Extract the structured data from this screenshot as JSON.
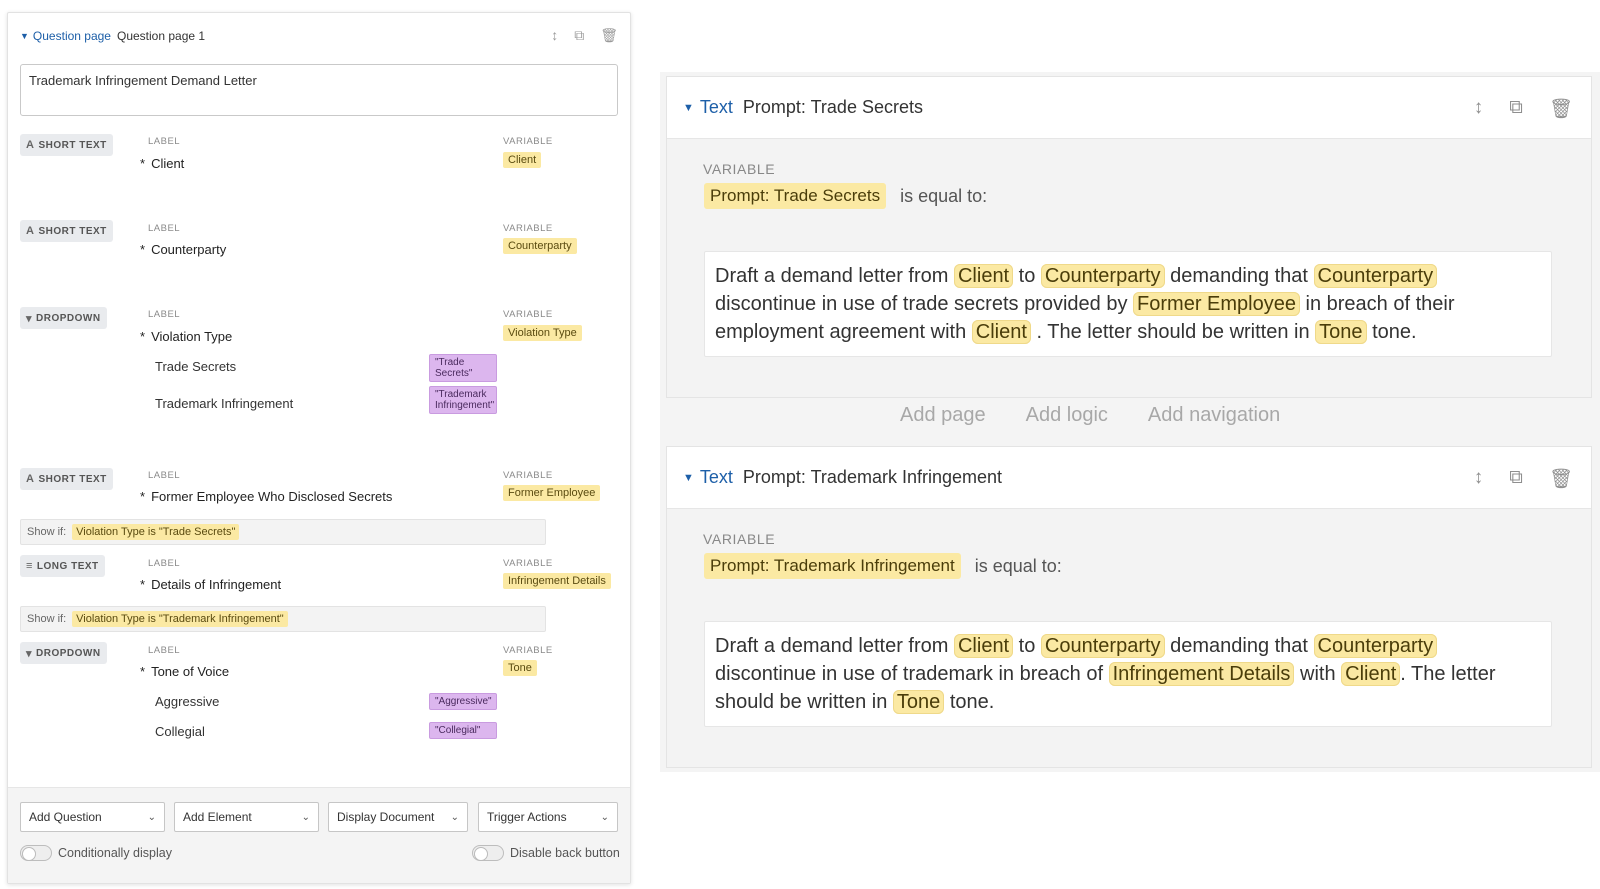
{
  "left": {
    "page_type": "Question page",
    "page_name": "Question page 1",
    "title_value": "Trademark Infringement Demand Letter",
    "label_caption": "LABEL",
    "variable_caption": "VARIABLE",
    "questions": [
      {
        "type": "SHORT TEXT",
        "label": "Client",
        "variable": "Client"
      },
      {
        "type": "SHORT TEXT",
        "label": "Counterparty",
        "variable": "Counterparty"
      },
      {
        "type": "DROPDOWN",
        "label": "Violation Type",
        "variable": "Violation Type",
        "options": [
          {
            "label": "Trade Secrets",
            "value": "\"Trade Secrets\""
          },
          {
            "label": "Trademark Infringement",
            "value": "\"Trademark Infringement\""
          }
        ]
      },
      {
        "type": "SHORT TEXT",
        "label": "Former Employee Who Disclosed Secrets",
        "variable": "Former Employee",
        "show_if": "Violation Type is \"Trade Secrets\""
      },
      {
        "type": "LONG TEXT",
        "label": "Details of Infringement",
        "variable": "Infringement Details",
        "show_if": "Violation Type is \"Trademark Infringement\""
      },
      {
        "type": "DROPDOWN",
        "label": "Tone of Voice",
        "variable": "Tone",
        "options": [
          {
            "label": "Aggressive",
            "value": "\"Aggressive\""
          },
          {
            "label": "Collegial",
            "value": "\"Collegial\""
          }
        ]
      }
    ],
    "show_if_label": "Show if:",
    "footer": {
      "add_question": "Add Question",
      "add_element": "Add Element",
      "display_document": "Display Document",
      "trigger_actions": "Trigger Actions",
      "conditionally_display": "Conditionally display",
      "disable_back": "Disable back button"
    }
  },
  "right": {
    "ghost_links": [
      "Add page",
      "Add logic",
      "Add navigation"
    ],
    "cards": [
      {
        "type": "Text",
        "name": "Prompt: Trade Secrets",
        "variable_caption": "VARIABLE",
        "variable": "Prompt: Trade Secrets",
        "equal_text": "is equal to:",
        "segments": [
          "Draft a demand letter from ",
          "Client",
          " to ",
          "Counterparty",
          " demanding that ",
          "Counterparty",
          " discontinue in use of trade secrets provided by ",
          "Former Employee",
          " in breach of their employment agreement with ",
          "Client",
          " . The letter should be written in ",
          "Tone",
          " tone."
        ]
      },
      {
        "type": "Text",
        "name": "Prompt: Trademark Infringement",
        "variable_caption": "VARIABLE",
        "variable": "Prompt: Trademark Infringement",
        "equal_text": "is equal to:",
        "segments": [
          "Draft a demand letter from ",
          "Client",
          " to ",
          "Counterparty",
          " demanding that ",
          "Counterparty",
          " discontinue in use of trademark in breach of ",
          "Infringement Details",
          " with ",
          "Client",
          ". The letter should be written in ",
          "Tone",
          " tone."
        ]
      }
    ]
  },
  "colors": {
    "accent": "#1d5fa8",
    "variable_chip": "#fbe9a3",
    "option_chip": "#dcb6ee"
  }
}
